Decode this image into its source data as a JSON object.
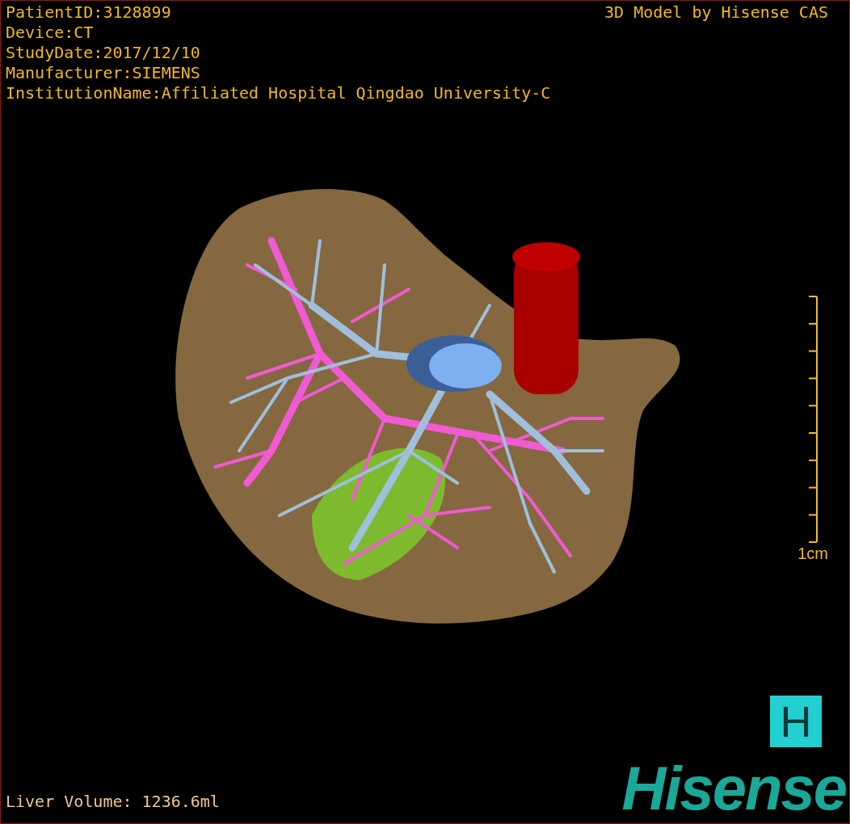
{
  "study_info": [
    "PatientID:3128899",
    "Device:CT",
    "StudyDate:2017/12/10",
    "Manufacturer:SIEMENS",
    "InstitutionName:Affiliated Hospital Qingdao University-C"
  ],
  "credit": "3D Model by Hisense CAS",
  "scale_bar": {
    "label": "1cm"
  },
  "volume": "Liver Volume: 1236.6ml",
  "logo": {
    "mark": "H",
    "wordmark": "Hisense"
  }
}
